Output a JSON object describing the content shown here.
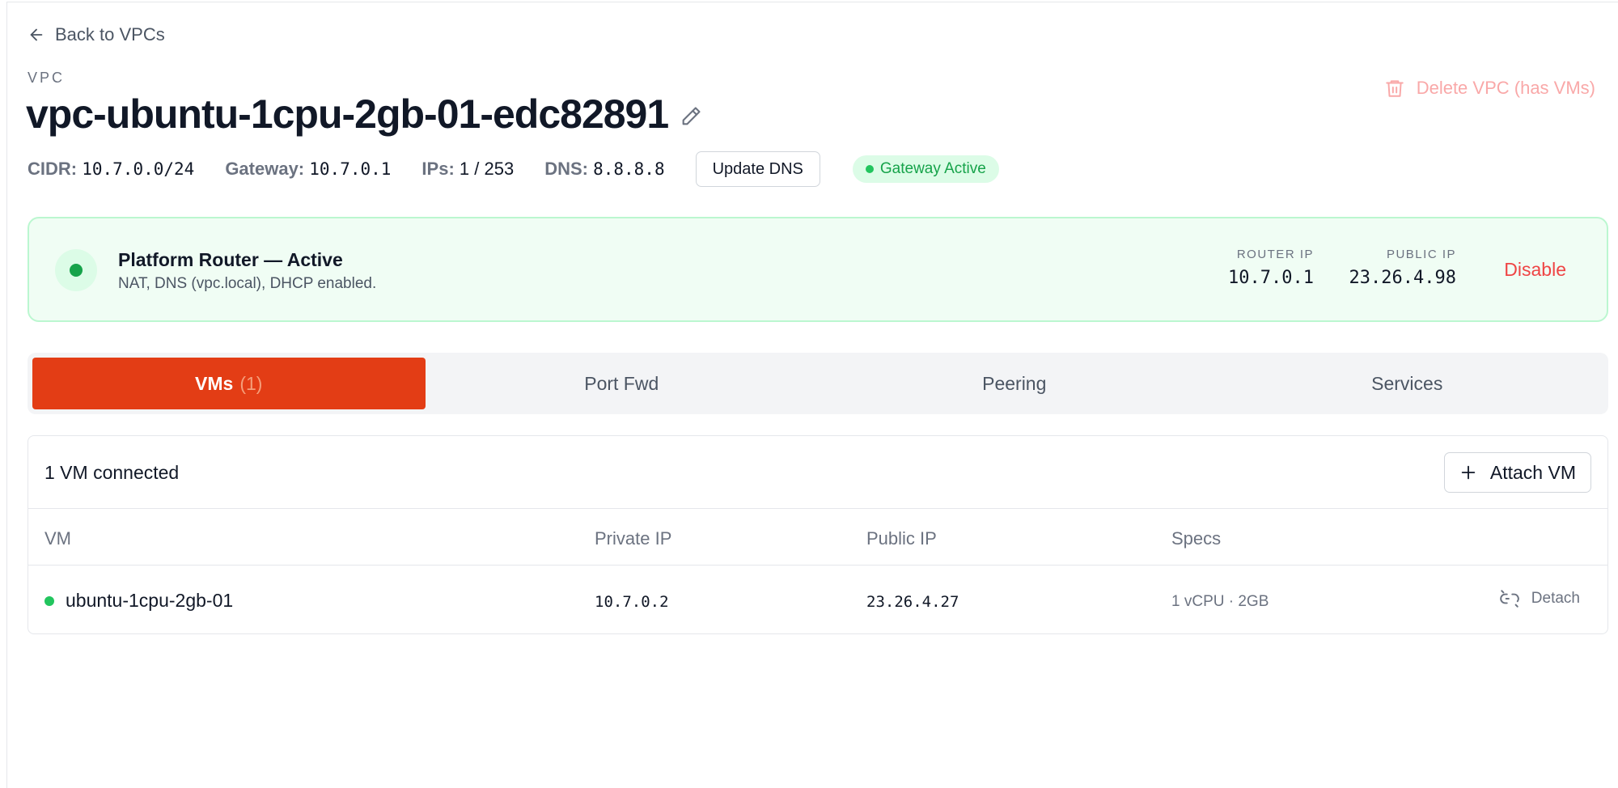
{
  "nav": {
    "back_label": "Back to VPCs"
  },
  "header": {
    "eyebrow": "VPC",
    "title": "vpc-ubuntu-1cpu-2gb-01-edc82891",
    "delete_label": "Delete VPC (has VMs)"
  },
  "meta": {
    "cidr_key": "CIDR:",
    "cidr_value": "10.7.0.0/24",
    "gateway_key": "Gateway:",
    "gateway_value": "10.7.0.1",
    "ips_key": "IPs:",
    "ips_value": "1 / 253",
    "dns_key": "DNS:",
    "dns_value": "8.8.8.8",
    "update_dns_label": "Update DNS",
    "gateway_status": "Gateway Active"
  },
  "router": {
    "title": "Platform Router — Active",
    "subtitle": "NAT, DNS (vpc.local), DHCP enabled.",
    "router_ip_label": "ROUTER IP",
    "router_ip": "10.7.0.1",
    "public_ip_label": "PUBLIC IP",
    "public_ip": "23.26.4.98",
    "disable_label": "Disable"
  },
  "tabs": [
    {
      "label": "VMs",
      "count": "(1)"
    },
    {
      "label": "Port Fwd"
    },
    {
      "label": "Peering"
    },
    {
      "label": "Services"
    }
  ],
  "vm_panel": {
    "count_label": "1 VM connected",
    "attach_label": "Attach VM",
    "columns": [
      "VM",
      "Private IP",
      "Public IP",
      "Specs"
    ],
    "rows": [
      {
        "name": "ubuntu-1cpu-2gb-01",
        "private_ip": "10.7.0.2",
        "public_ip": "23.26.4.27",
        "specs": "1 vCPU · 2GB",
        "action": "Detach"
      }
    ]
  },
  "colors": {
    "accent": "#e33d15",
    "success": "#16a34a",
    "danger": "#ef4444"
  }
}
